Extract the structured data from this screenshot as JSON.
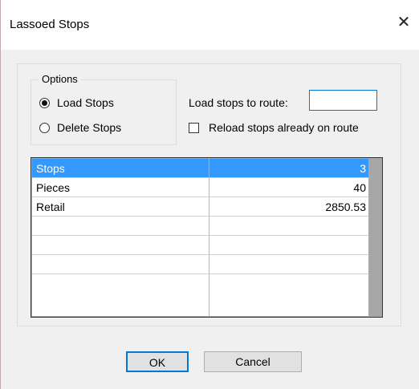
{
  "window": {
    "title": "Lassoed Stops",
    "close_glyph": "✕"
  },
  "options": {
    "group_label": "Options",
    "load_label": "Load Stops",
    "delete_label": "Delete Stops",
    "selected": "load"
  },
  "route": {
    "label": "Load stops to route:",
    "value": ""
  },
  "reload": {
    "label": "Reload stops already on route",
    "checked": false
  },
  "grid": {
    "rows": [
      {
        "name": "Stops",
        "value": "3",
        "selected": true
      },
      {
        "name": "Pieces",
        "value": "40"
      },
      {
        "name": "Retail",
        "value": "2850.53"
      },
      {
        "name": "",
        "value": ""
      },
      {
        "name": "",
        "value": ""
      },
      {
        "name": "",
        "value": ""
      }
    ],
    "selection_color": "#3399ff"
  },
  "buttons": {
    "ok_label": "OK",
    "cancel_label": "Cancel"
  }
}
